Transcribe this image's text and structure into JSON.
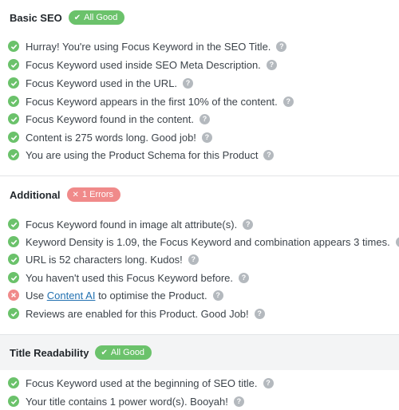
{
  "basic_seo": {
    "title": "Basic SEO",
    "badge": "All Good",
    "items": [
      "Hurray! You're using Focus Keyword in the SEO Title.",
      "Focus Keyword used inside SEO Meta Description.",
      "Focus Keyword used in the URL.",
      "Focus Keyword appears in the first 10% of the content.",
      "Focus Keyword found in the content.",
      "Content is 275 words long. Good job!",
      "You are using the Product Schema for this Product"
    ]
  },
  "additional": {
    "title": "Additional",
    "badge": "1 Errors",
    "items": [
      "Focus Keyword found in image alt attribute(s).",
      "Keyword Density is 1.09, the Focus Keyword and combination appears 3 times.",
      "URL is 52 characters long. Kudos!",
      "You haven't used this Focus Keyword before.",
      {
        "before": "Use ",
        "link": "Content AI",
        "after": " to optimise the Product."
      },
      "Reviews are enabled for this Product. Good Job!"
    ]
  },
  "title_readability": {
    "title": "Title Readability",
    "badge": "All Good",
    "items": [
      "Focus Keyword used at the beginning of SEO title.",
      "Your title contains 1 power word(s). Booyah!"
    ]
  },
  "colors": {
    "good": "#6bc26b",
    "error": "#f08a8a",
    "help": "#b4b9be",
    "link": "#2271b1"
  },
  "icons": {
    "ok": "check-circle-icon",
    "fail": "x-circle-icon",
    "help": "question-mark-icon"
  }
}
